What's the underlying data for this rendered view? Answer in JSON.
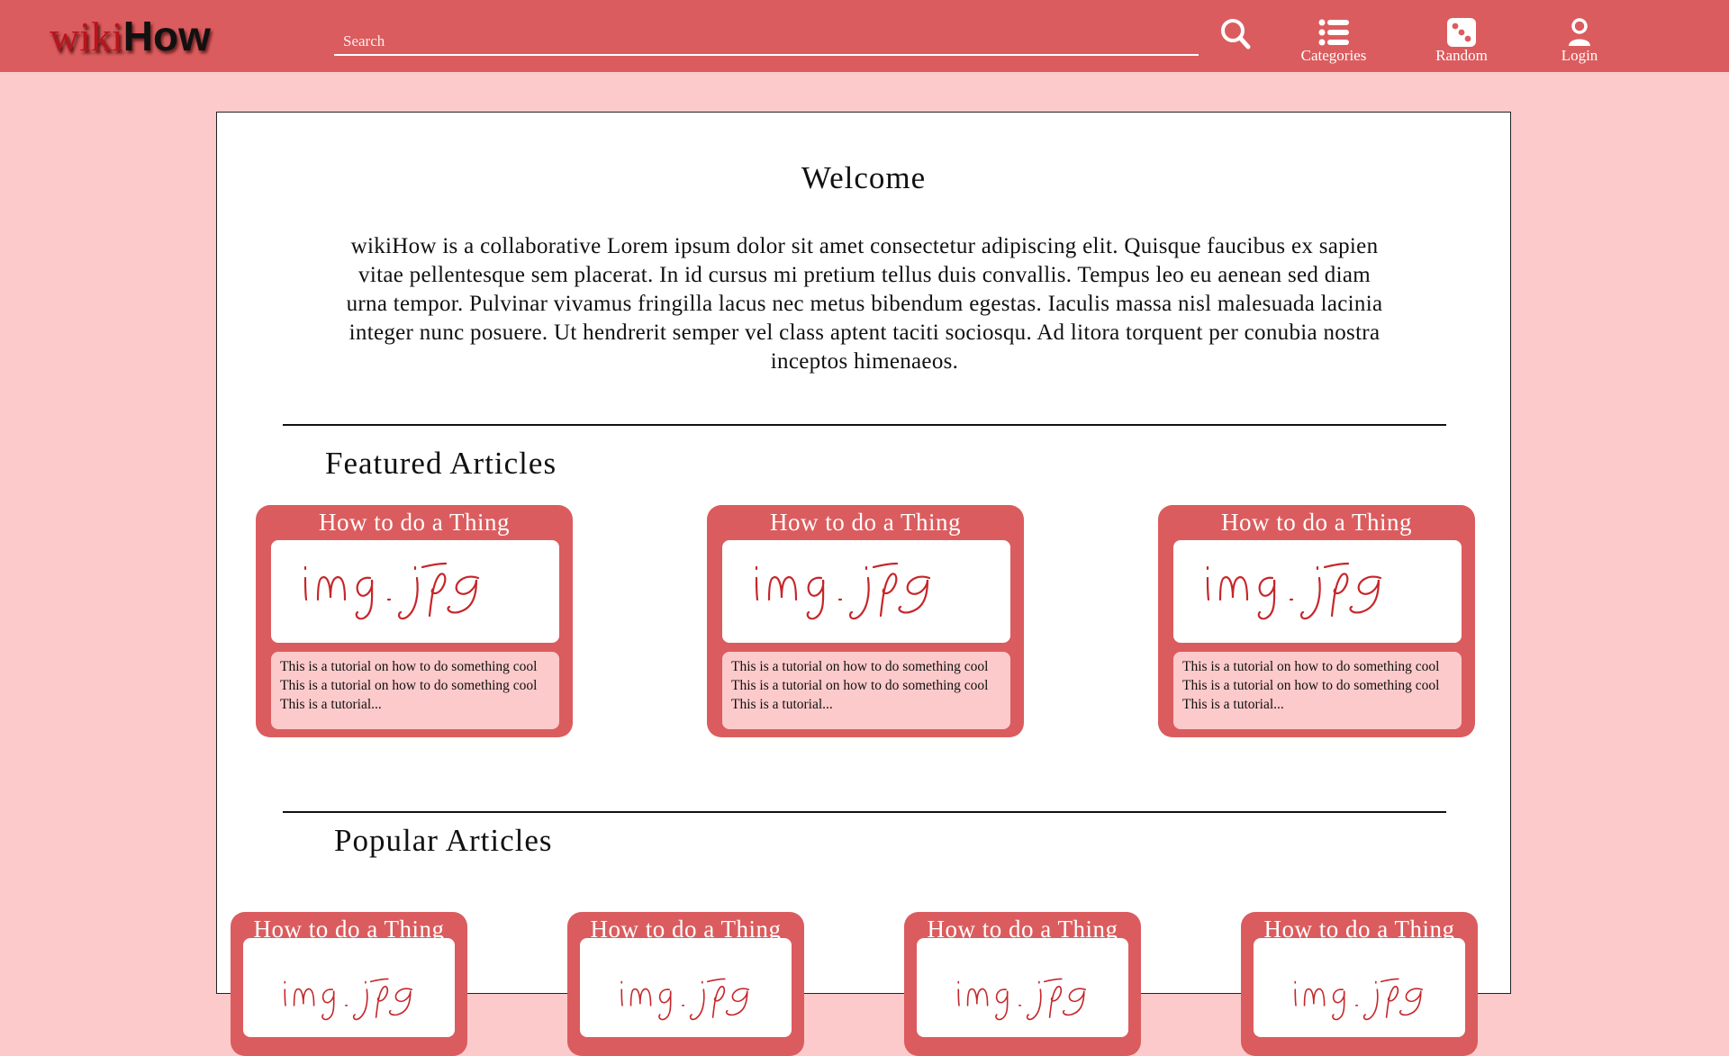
{
  "header": {
    "logo_wiki": "wiki",
    "logo_how": "How",
    "search_placeholder": "Search",
    "nav": [
      {
        "label": "Categories",
        "icon": "list-icon"
      },
      {
        "label": "Random",
        "icon": "dice-icon"
      },
      {
        "label": "Login",
        "icon": "user-icon"
      }
    ]
  },
  "colors": {
    "header_bg": "#db5c5e",
    "page_bg": "#fccacb",
    "card_bg": "#db5c5e",
    "card_desc_bg": "#fccacb",
    "img_scribble": "#c6262a"
  },
  "main": {
    "welcome_title": "Welcome",
    "intro": "wikiHow is a collaborative Lorem ipsum dolor sit amet consectetur adipiscing elit. Quisque faucibus ex sapien vitae pellentesque sem placerat. In id cursus mi pretium tellus duis convallis. Tempus leo eu aenean sed diam urna tempor. Pulvinar vivamus fringilla lacus nec metus bibendum egestas. Iaculis massa nisl malesuada lacinia integer nunc posuere. Ut hendrerit semper vel class aptent taciti sociosqu. Ad litora torquent per conubia nostra inceptos himenaeos.",
    "featured_title": "Featured Articles",
    "featured": [
      {
        "title": "How to do a Thing",
        "image_text": "img.jpg",
        "description": "This is a tutorial on how to do something cool This is a tutorial on how to do something cool This is a tutorial..."
      },
      {
        "title": "How to do a Thing",
        "image_text": "img.jpg",
        "description": "This is a tutorial on how to do something cool This is a tutorial on how to do something cool This is a tutorial..."
      },
      {
        "title": "How to do a Thing",
        "image_text": "img.jpg",
        "description": "This is a tutorial on how to do something cool This is a tutorial on how to do something cool This is a tutorial..."
      }
    ],
    "popular_title": "Popular Articles",
    "popular": [
      {
        "title": "How to do a Thing",
        "image_text": "img.jpg"
      },
      {
        "title": "How to do a Thing",
        "image_text": "img.jpg"
      },
      {
        "title": "How to do a Thing",
        "image_text": "img.jpg"
      },
      {
        "title": "How to do a Thing",
        "image_text": "img.jpg"
      }
    ]
  }
}
